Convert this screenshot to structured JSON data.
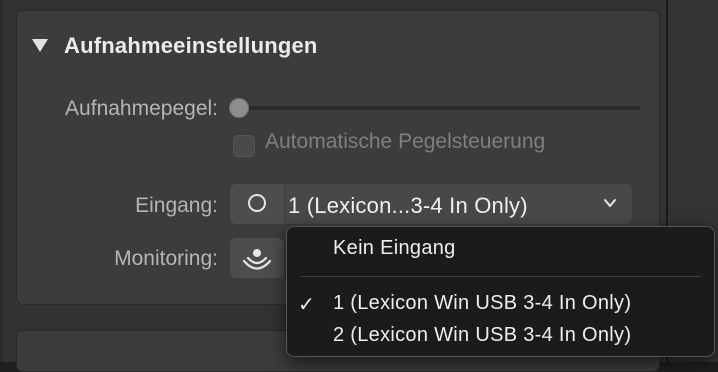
{
  "section": {
    "title": "Aufnahmeeinstellungen",
    "expanded": true
  },
  "recording_level": {
    "label": "Aufnahmepegel:",
    "value": 0
  },
  "auto_level": {
    "label": "Automatische Pegelsteuerung",
    "checked": false,
    "enabled": false
  },
  "input": {
    "label": "Eingang:",
    "selected": "1  (Lexicon...3-4 In Only)",
    "icon": "circle-input-icon"
  },
  "monitoring": {
    "label": "Monitoring:",
    "icon": "monitoring-waves-icon"
  },
  "dropdown_menu": {
    "items": [
      {
        "label": "Kein Eingang",
        "checked": false
      },
      {
        "label": "1  (Lexicon Win USB 3-4 In Only)",
        "checked": true
      },
      {
        "label": "2  (Lexicon Win USB 3-4 In Only)",
        "checked": false
      }
    ],
    "check_glyph": "✓"
  }
}
